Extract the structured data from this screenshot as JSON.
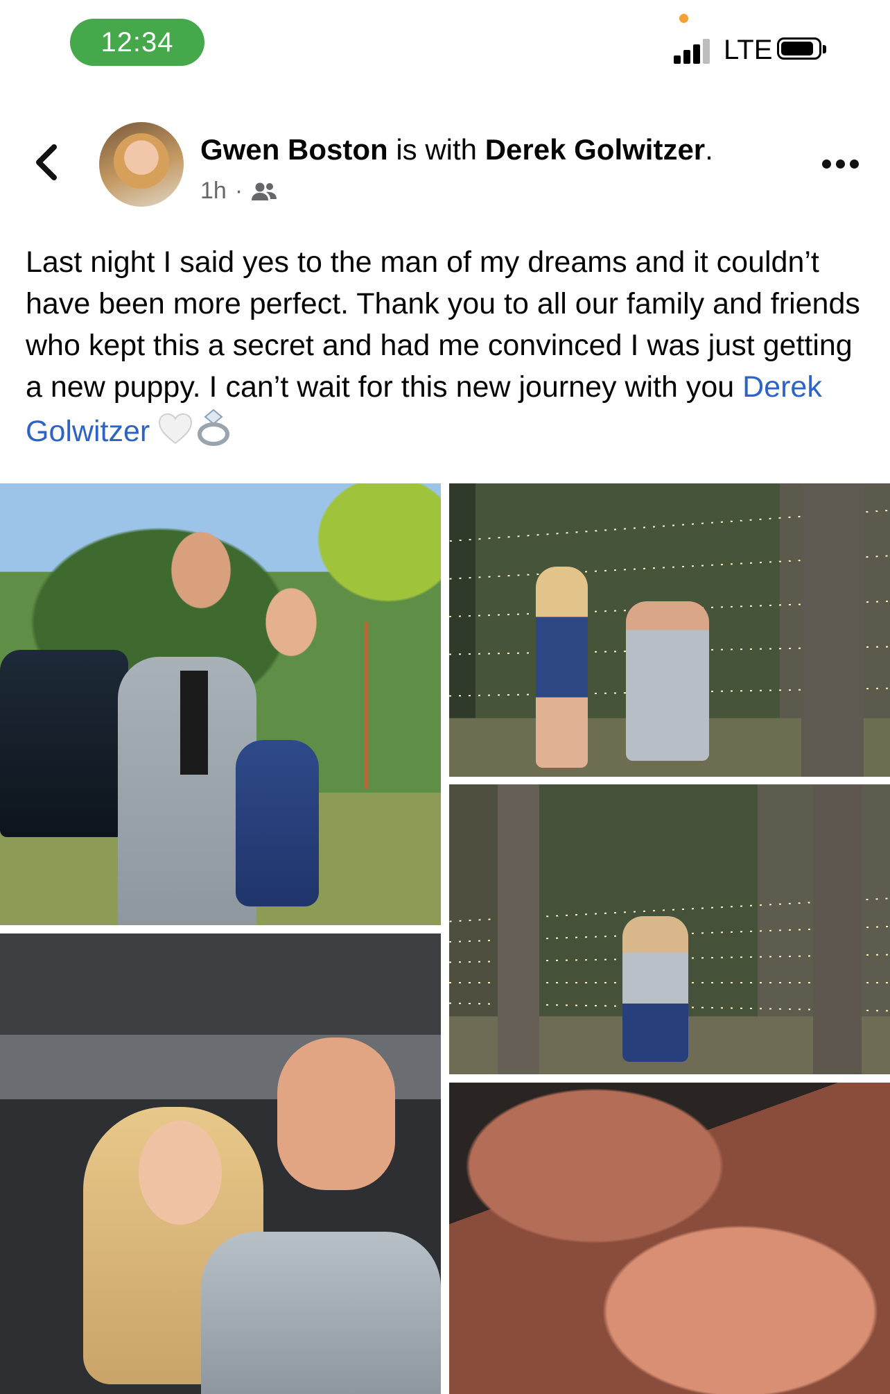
{
  "status_bar": {
    "time": "12:34",
    "carrier": "LTE",
    "colors": {
      "time_pill": "#45a84a",
      "mic_indicator": "#f2a132"
    }
  },
  "header": {
    "author": "Gwen Boston",
    "connector": " is with ",
    "tagged": "Derek Golwitzer",
    "period": ".",
    "time_ago": "1h",
    "separator": "·",
    "audience_icon": "friends-icon",
    "back_icon": "chevron-left-icon",
    "more_icon": "more-horizontal-icon"
  },
  "post": {
    "text": "Last night I said yes to the man of my dreams and it couldn’t have been more perfect. Thank you to all our family and friends who kept this a secret and had me convinced I was just getting a new puppy. I can’t wait for this new journey with you ",
    "mention": "Derek Golwitzer",
    "emoji": [
      "white-heart-emoji",
      "ring-emoji"
    ],
    "mention_color": "#2d62c7"
  },
  "photos": [
    {
      "name": "photo-couple-outdoors"
    },
    {
      "name": "photo-proposal-kneeling"
    },
    {
      "name": "photo-proposal-hug"
    },
    {
      "name": "photo-car-selfie"
    },
    {
      "name": "photo-ring-hand"
    }
  ]
}
